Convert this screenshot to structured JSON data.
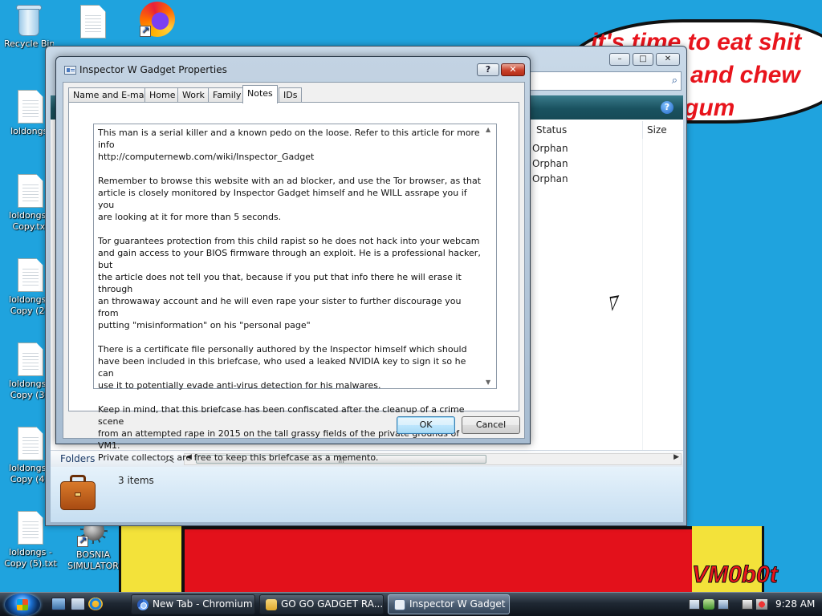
{
  "wallpaper": {
    "bubble_lines": [
      "it's time to eat shit",
      "and chew",
      "gum"
    ],
    "signature": "VM0b0t"
  },
  "desktop": {
    "icons": [
      {
        "label": "Recycle Bin",
        "type": "recycle-bin"
      },
      {
        "label": "",
        "type": "text-file"
      },
      {
        "label": "",
        "type": "firefox-shortcut"
      },
      {
        "label": "loldongs.",
        "type": "text-file"
      },
      {
        "label": "loldongs - Copy.txt",
        "type": "text-file"
      },
      {
        "label": "loldongs - Copy (2).",
        "type": "text-file"
      },
      {
        "label": "loldongs - Copy (3).",
        "type": "text-file"
      },
      {
        "label": "loldongs - Copy (4).",
        "type": "text-file"
      },
      {
        "label": "loldongs - Copy (5).txt",
        "type": "text-file"
      },
      {
        "label": "BOSNIA SIMULATOR",
        "type": "shortcut"
      }
    ]
  },
  "explorer": {
    "columns": [
      "Status",
      "Size"
    ],
    "rows": [
      {
        "status": "Orphan"
      },
      {
        "status": "Orphan"
      },
      {
        "status": "Orphan"
      }
    ],
    "folders_label": "Folders",
    "item_count": "3 items",
    "window_buttons": {
      "minimize": "–",
      "maximize": "□",
      "close": "✕"
    }
  },
  "dialog": {
    "title": "Inspector W Gadget Properties",
    "help_button": "?",
    "close_button": "✕",
    "tabs": [
      "Name and E-mail",
      "Home",
      "Work",
      "Family",
      "Notes",
      "IDs"
    ],
    "active_tab": "Notes",
    "notes_text": "This man is a serial killer and a known pedo on the loose. Refer to this article for more info\nhttp://computernewb.com/wiki/Inspector_Gadget\n\nRemember to browse this website with an ad blocker, and use the Tor browser, as that\narticle is closely monitored by Inspector Gadget himself and he WILL assrape you if you\nare looking at it for more than 5 seconds.\n\nTor guarantees protection from this child rapist so he does not hack into your webcam\nand gain access to your BIOS firmware through an exploit. He is a professional hacker, but\nthe article does not tell you that, because if you put that info there he will erase it through\nan throwaway account and he will even rape your sister to further discourage you from\nputting \"misinformation\" on his \"personal page\"\n\nThere is a certificate file personally authored by the Inspector himself which should\nhave been included in this briefcase, who used a leaked NVIDIA key to sign it so he can\nuse it to potentially evade anti-virus detection for his malwares.\n\nKeep in mind, that this briefcase has been confiscated after the cleanup of a crime scene\nfrom an attempted rape in 2015 on the tall grassy fields of the private grounds of VM1.\nPrivate collectors are free to keep this briefcase as a memento.",
    "ok_label": "OK",
    "cancel_label": "Cancel"
  },
  "taskbar": {
    "buttons": [
      {
        "label": "New Tab - Chromium",
        "icon": "chromium-icon",
        "active": false
      },
      {
        "label": "GO GO GADGET RA...",
        "icon": "folder-icon",
        "active": false
      },
      {
        "label": "Inspector W Gadget ...",
        "icon": "properties-icon",
        "active": true
      }
    ],
    "clock": "9:28 AM"
  },
  "colors": {
    "wallpaper_blue": "#1fa3de",
    "bubble_text_red": "#e8141c",
    "taskbar_dark": "#1f2833"
  }
}
